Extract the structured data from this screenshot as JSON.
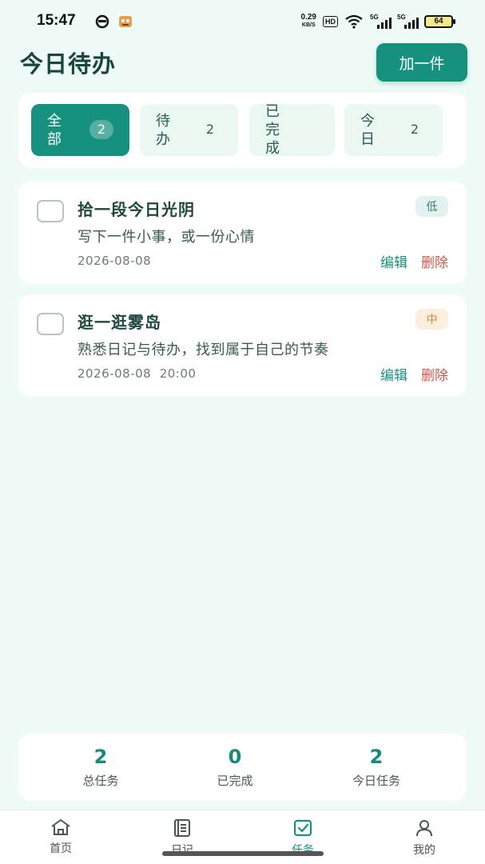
{
  "status_bar": {
    "time": "15:47",
    "network_speed": "0.29",
    "network_unit": "KB/S",
    "hd_label": "HD",
    "signal1_label": "5G",
    "signal2_label": "5G",
    "battery": "64",
    "left_icons": [
      "circle-app-icon",
      "game-app-icon"
    ]
  },
  "header": {
    "title": "今日待办",
    "add_button": "加一件"
  },
  "filters": [
    {
      "label": "全部",
      "count": "2",
      "active": true
    },
    {
      "label": "待办",
      "count": "2",
      "active": false
    },
    {
      "label": "已完成",
      "count": "",
      "active": false
    },
    {
      "label": "今日",
      "count": "2",
      "active": false
    }
  ],
  "tasks": [
    {
      "title": "拾一段今日光阴",
      "desc": "写下一件小事，或一份心情",
      "date": "2026-08-08",
      "priority": "低",
      "edit": "编辑",
      "delete": "删除"
    },
    {
      "title": "逛一逛雾岛",
      "desc": "熟悉日记与待办，找到属于自己的节奏",
      "date": "2026-08-08  20:00",
      "priority": "中",
      "edit": "编辑",
      "delete": "删除"
    }
  ],
  "stats": [
    {
      "value": "2",
      "label": "总任务"
    },
    {
      "value": "0",
      "label": "已完成"
    },
    {
      "value": "2",
      "label": "今日任务"
    }
  ],
  "nav": [
    {
      "label": "首页",
      "icon": "home-icon",
      "active": false
    },
    {
      "label": "日记",
      "icon": "notebook-icon",
      "active": false
    },
    {
      "label": "任务",
      "icon": "checkbox-icon",
      "active": true
    },
    {
      "label": "我的",
      "icon": "user-icon",
      "active": false
    }
  ],
  "colors": {
    "accent": "#17917f",
    "background": "#eefbf6",
    "delete": "#d0554d",
    "priority_low_bg": "#e3f2f0",
    "priority_mid_bg": "#fdeedd"
  }
}
